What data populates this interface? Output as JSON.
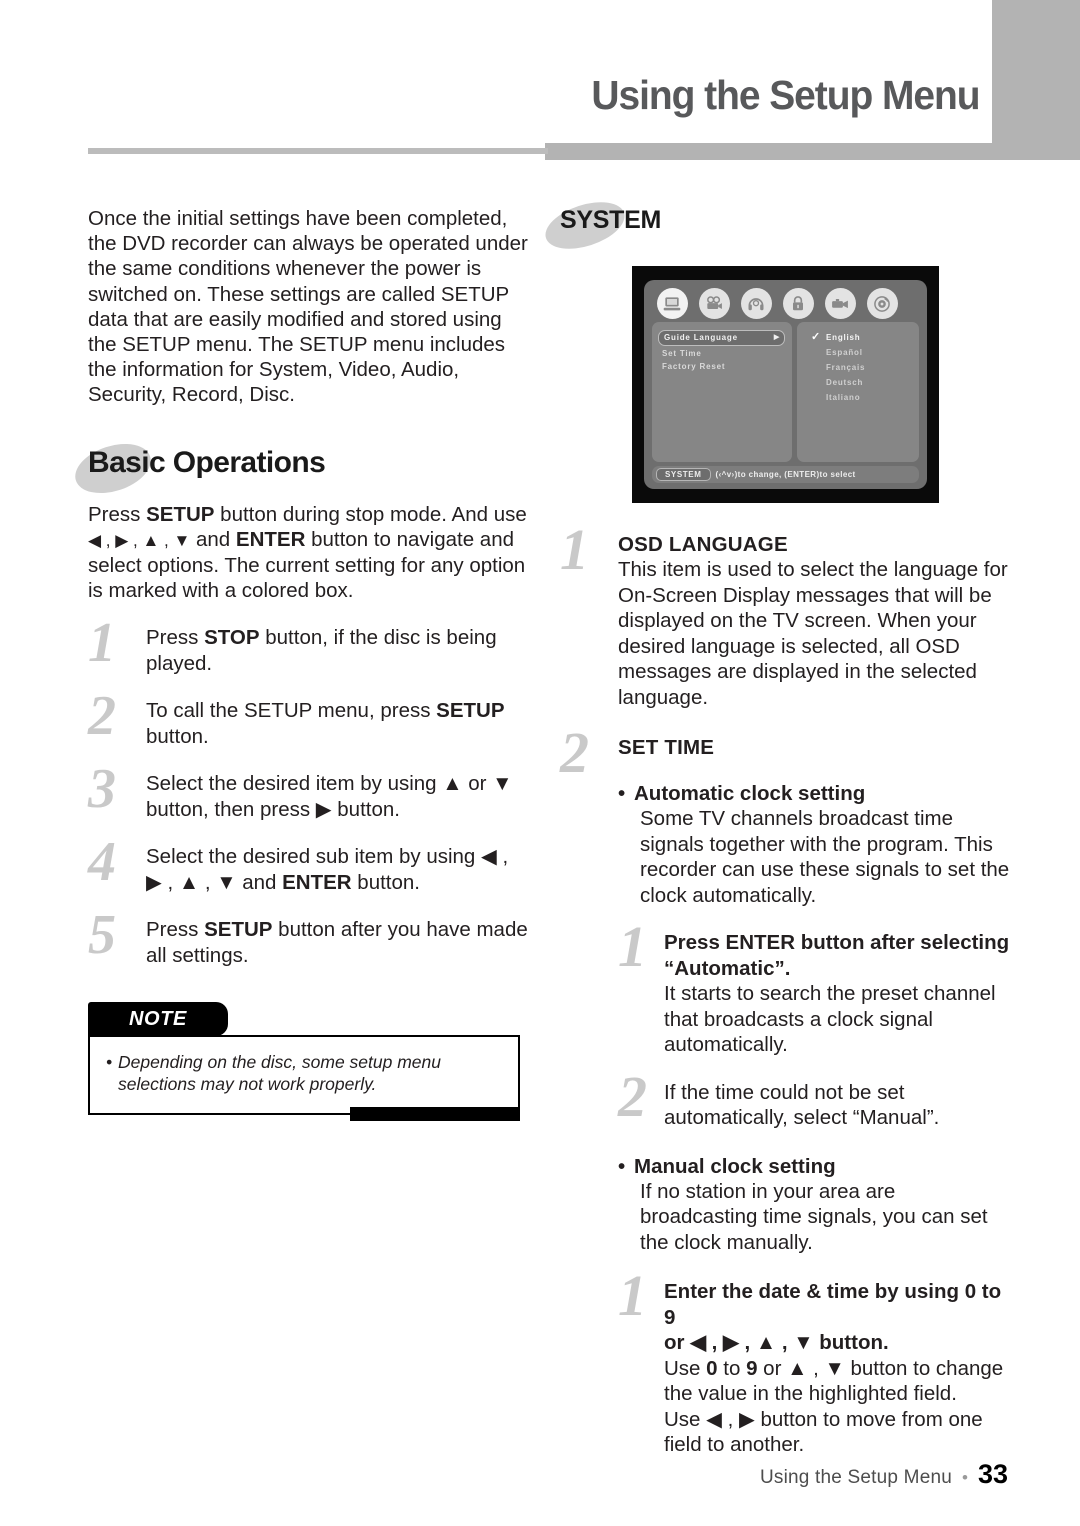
{
  "header": {
    "title": "Using the Setup Menu"
  },
  "left": {
    "intro": "Once the initial settings have been completed, the DVD recorder can always be operated under the same conditions whenever the power is switched on. These settings are called SETUP data that are easily modified and stored using the SETUP menu. The SETUP menu includes the information for System, Video, Audio, Security, Record, Disc.",
    "basic_heading": "Basic Operations",
    "basic_intro_1": "Press ",
    "basic_intro_setup": "SETUP",
    "basic_intro_2": " button during stop mode. And use ",
    "basic_intro_keys": "◀ , ▶ , ▲ , ▼",
    "basic_intro_3": " and ",
    "basic_intro_enter": "ENTER",
    "basic_intro_4": " button to navigate and select options. The current setting for any option is marked with a colored box.",
    "steps": [
      {
        "num": "1",
        "pre": "Press ",
        "bold": "STOP",
        "post": " button, if the disc is being played."
      },
      {
        "num": "2",
        "pre": "To call the SETUP menu, press ",
        "bold": "SETUP",
        "post": " button."
      },
      {
        "num": "3",
        "pre": "Select the desired item by using  ▲ or ▼ button, then press ▶ button.",
        "bold": "",
        "post": ""
      },
      {
        "num": "4",
        "pre": "Select the desired sub item by using ◀ , ▶ , ▲ , ▼  and ",
        "bold": "ENTER",
        "post": " button."
      },
      {
        "num": "5",
        "pre": "Press ",
        "bold": "SETUP",
        "post": " button after you have made all settings."
      }
    ],
    "note": {
      "tab_label": "NOTE",
      "text": "Depending on the disc, some setup menu selections may not work properly."
    }
  },
  "right": {
    "system_heading": "SYSTEM",
    "osd": {
      "tabs": [
        {
          "name": "system-tab",
          "icon": "monitor-icon",
          "active": true
        },
        {
          "name": "video-tab",
          "icon": "movie-camera-icon",
          "active": false
        },
        {
          "name": "audio-tab",
          "icon": "headphone-icon",
          "active": false
        },
        {
          "name": "security-tab",
          "icon": "lock-icon",
          "active": false
        },
        {
          "name": "record-tab",
          "icon": "camcorder-icon",
          "active": false
        },
        {
          "name": "disc-tab",
          "icon": "disc-icon",
          "active": false
        }
      ],
      "menu_items": [
        {
          "label": "Guide Language",
          "selected": true,
          "arrow": "▶"
        },
        {
          "label": "Set Time",
          "selected": false,
          "arrow": ""
        },
        {
          "label": "Factory Reset",
          "selected": false,
          "arrow": ""
        }
      ],
      "languages": [
        {
          "label": "English",
          "checked": true
        },
        {
          "label": "Español",
          "checked": false
        },
        {
          "label": "Français",
          "checked": false
        },
        {
          "label": "Deutsch",
          "checked": false
        },
        {
          "label": "Italiano",
          "checked": false
        }
      ],
      "status_tag": "SYSTEM",
      "status_hint": "(‹^v›)to change, (ENTER)to select"
    },
    "sections": [
      {
        "num": "1",
        "heading": "OSD LANGUAGE",
        "text": "This item is used to select the language for On-Screen Display messages that will be displayed on the TV screen. When your desired language is selected, all OSD messages are displayed in the selected language."
      },
      {
        "num": "2",
        "heading": "SET TIME",
        "text": ""
      }
    ],
    "auto_bullet": {
      "heading": "Automatic clock setting",
      "text": "Some TV channels broadcast time signals together with the program. This recorder can use these signals to set the clock automatically."
    },
    "auto_steps": [
      {
        "num": "1",
        "bold": "Press ENTER button after selecting “Automatic”.",
        "text": "It starts to search the preset channel that broadcasts a clock signal automatically."
      },
      {
        "num": "2",
        "bold": "",
        "text": "If the time could not be set automatically, select “Manual”."
      }
    ],
    "manual_bullet": {
      "heading": "Manual clock setting",
      "text": "If no station in your area are broadcasting time signals, you can set the clock manually."
    },
    "manual_step": {
      "num": "1",
      "bold_line1": "Enter the date & time by using 0 to 9",
      "bold_line2": "or ◀ , ▶ , ▲ , ▼  button.",
      "text_a1": "Use ",
      "text_a_b1": "0",
      "text_a2": " to ",
      "text_a_b2": "9",
      "text_a3": " or  ▲ , ▼  button to change the value in the highlighted field.",
      "text_b1": "Use ◀ , ▶ button to move from one field to another."
    }
  },
  "footer": {
    "title": "Using the Setup Menu",
    "dot": "•",
    "page": "33"
  }
}
